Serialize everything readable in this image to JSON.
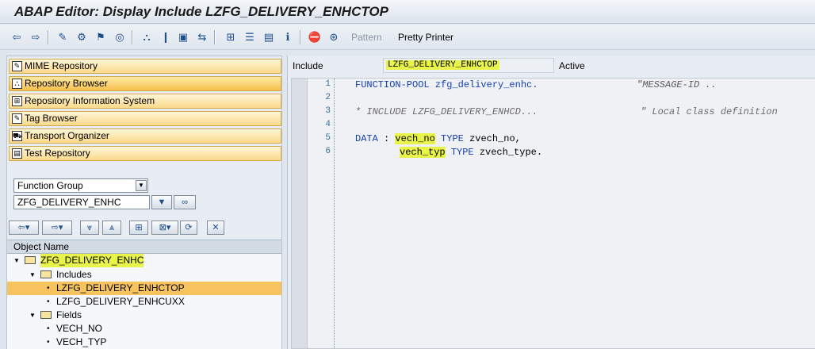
{
  "window": {
    "title": "ABAP Editor: Display Include LZFG_DELIVERY_ENHCTOP"
  },
  "toolbar": {
    "pattern_label": "Pattern",
    "pretty_printer_label": "Pretty Printer"
  },
  "nav": {
    "items": [
      {
        "label": "MIME Repository",
        "icon": "mime-repository-icon"
      },
      {
        "label": "Repository Browser",
        "icon": "repository-browser-icon"
      },
      {
        "label": "Repository Information System",
        "icon": "info-system-icon"
      },
      {
        "label": "Tag Browser",
        "icon": "tag-browser-icon"
      },
      {
        "label": "Transport Organizer",
        "icon": "transport-icon"
      },
      {
        "label": "Test Repository",
        "icon": "test-repository-icon"
      }
    ],
    "object_type": "Function Group",
    "object_name": "ZFG_DELIVERY_ENHC"
  },
  "tree": {
    "header": "Object Name",
    "nodes": [
      {
        "label": "ZFG_DELIVERY_ENHC"
      },
      {
        "label": "Includes"
      },
      {
        "label": "LZFG_DELIVERY_ENHCTOP"
      },
      {
        "label": "LZFG_DELIVERY_ENHCUXX"
      },
      {
        "label": "Fields"
      },
      {
        "label": "VECH_NO"
      },
      {
        "label": "VECH_TYP"
      }
    ]
  },
  "editor": {
    "include_label": "Include",
    "include_name": "LZFG_DELIVERY_ENHCTOP",
    "status": "Active",
    "lines": [
      {
        "no": "1",
        "text": "FUNCTION-POOL zfg_delivery_enhc.",
        "comment": "\"MESSAGE-ID .."
      },
      {
        "no": "2",
        "text": "",
        "comment": ""
      },
      {
        "no": "3",
        "text": "* INCLUDE LZFG_DELIVERY_ENHCD...",
        "comment": "\" Local class definition"
      },
      {
        "no": "4",
        "text": "",
        "comment": ""
      },
      {
        "no": "5",
        "kw1": "DATA",
        "sep": " : ",
        "var": "vech_no",
        "kw2": "TYPE",
        "rest": "zvech_no,"
      },
      {
        "no": "6",
        "var": "vech_typ",
        "kw2": "TYPE",
        "rest": "zvech_type."
      }
    ]
  }
}
